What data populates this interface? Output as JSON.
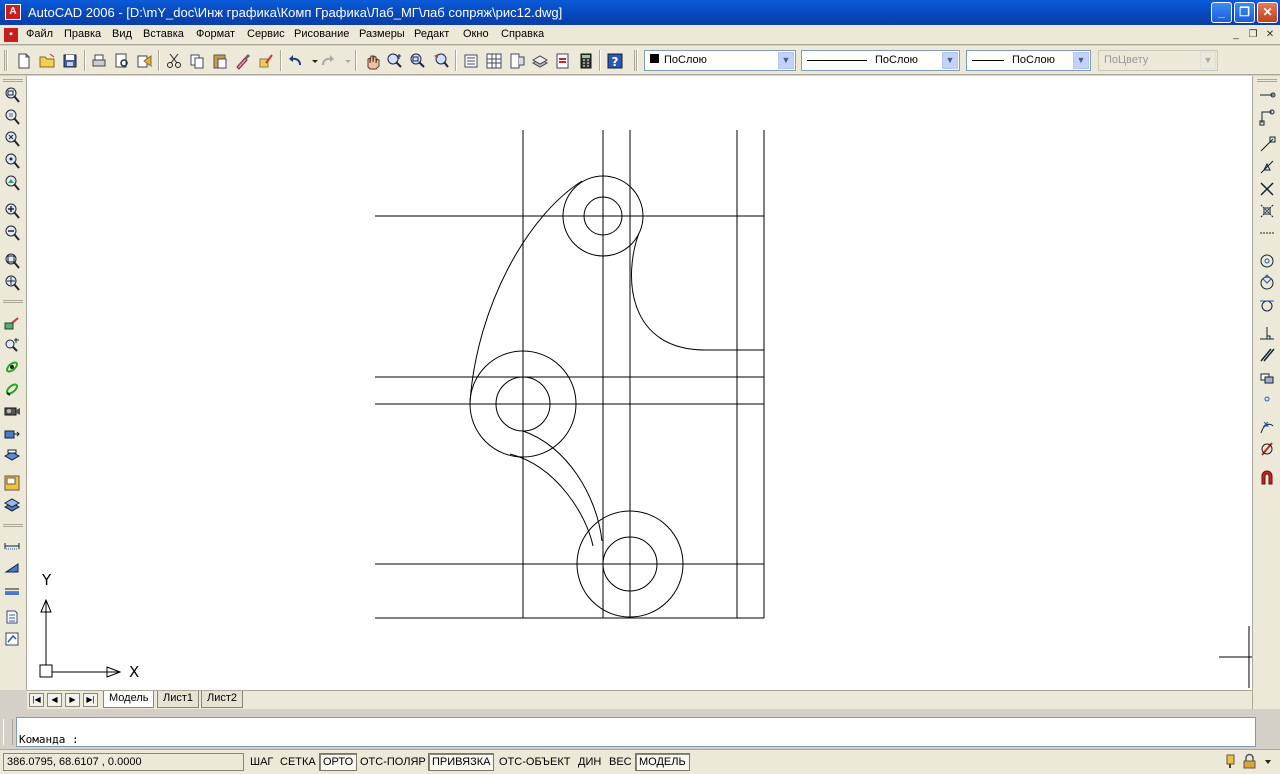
{
  "window": {
    "title": "AutoCAD 2006 - [D:\\mY_doc\\Инж графика\\Комп Графика\\Лаб_МГ\\лаб сопряж\\рис12.dwg]",
    "app_icon_glyph": "A"
  },
  "menu": {
    "items": [
      "Файл",
      "Правка",
      "Вид",
      "Вставка",
      "Формат",
      "Сервис",
      "Рисование",
      "Размеры",
      "Редакт",
      "Окно",
      "Справка"
    ]
  },
  "properties": {
    "layer": "ПоСлою",
    "linetype": "ПоСлою",
    "lineweight": "ПоСлою",
    "color": "ПоЦвету"
  },
  "ucs": {
    "x_label": "X",
    "y_label": "Y"
  },
  "layout_tabs": [
    "Модель",
    "Лист1",
    "Лист2"
  ],
  "command": {
    "prompt": "Команда :"
  },
  "status": {
    "coordinates": "386.0795, 68.6107 , 0.0000",
    "toggles": [
      {
        "label": "ШАГ",
        "on": false
      },
      {
        "label": "СЕТКА",
        "on": false
      },
      {
        "label": "ОРТО",
        "on": true
      },
      {
        "label": "ОТС-ПОЛЯР",
        "on": false
      },
      {
        "label": "ПРИВЯЗКА",
        "on": true
      },
      {
        "label": "ОТС-ОБЪЕКТ",
        "on": false
      },
      {
        "label": "ДИН",
        "on": false
      },
      {
        "label": "ВЕС",
        "on": false
      },
      {
        "label": "МОДЕЛЬ",
        "on": true
      }
    ]
  },
  "colors": {
    "title_bar": "#0a5bd9",
    "chrome": "#ece9d8",
    "canvas": "#ffffff",
    "lines": "#000000"
  }
}
